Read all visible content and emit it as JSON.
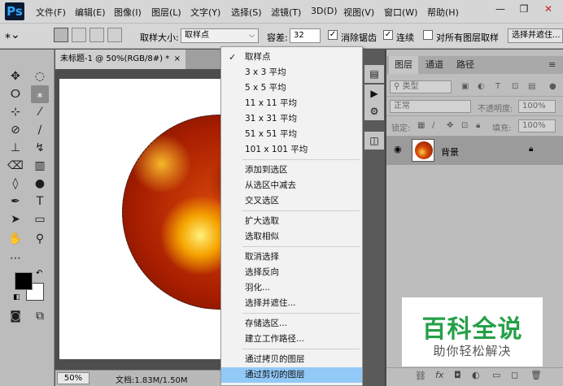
{
  "app": {
    "logo": "Ps"
  },
  "menubar": {
    "items": [
      "文件(F)",
      "编辑(E)",
      "图像(I)",
      "图层(L)",
      "文字(Y)",
      "选择(S)",
      "滤镜(T)",
      "3D(D)",
      "视图(V)",
      "窗口(W)",
      "帮助(H)"
    ]
  },
  "window_controls": {
    "minimize": "—",
    "restore": "❐",
    "close": "✕"
  },
  "options_bar": {
    "sample_size_label": "取样大小:",
    "sample_size_value": "取样点",
    "tolerance_label": "容差:",
    "tolerance_value": "32",
    "antialias_label": "消除锯齿",
    "contiguous_label": "连续",
    "all_layers_label": "对所有图层取样",
    "select_mask_label": "选择并遮住..."
  },
  "document": {
    "tab_title": "未标题-1 @ 50%(RGB/8#) *",
    "tab_close": "×",
    "zoom": "50%",
    "doc_info": "文档:1.83M/1.50M"
  },
  "context_menu": {
    "items": [
      {
        "label": "取样点",
        "checked": true,
        "group": 0
      },
      {
        "label": "3 x 3 平均",
        "group": 0
      },
      {
        "label": "5 x 5 平均",
        "group": 0
      },
      {
        "label": "11 x 11 平均",
        "group": 0
      },
      {
        "label": "31 x 31 平均",
        "group": 0
      },
      {
        "label": "51 x 51 平均",
        "group": 0
      },
      {
        "label": "101 x 101 平均",
        "group": 0
      },
      {
        "label": "添加到选区",
        "group": 1
      },
      {
        "label": "从选区中减去",
        "group": 1
      },
      {
        "label": "交叉选区",
        "group": 1
      },
      {
        "label": "扩大选取",
        "group": 2
      },
      {
        "label": "选取相似",
        "group": 2
      },
      {
        "label": "取消选择",
        "group": 3
      },
      {
        "label": "选择反向",
        "group": 3
      },
      {
        "label": "羽化...",
        "group": 3
      },
      {
        "label": "选择并遮住...",
        "group": 3
      },
      {
        "label": "存储选区...",
        "group": 4
      },
      {
        "label": "建立工作路径...",
        "group": 4
      },
      {
        "label": "通过拷贝的图层",
        "group": 5
      },
      {
        "label": "通过剪切的图层",
        "group": 5,
        "highlighted": true
      }
    ]
  },
  "layers_panel": {
    "tabs": [
      "图层",
      "通道",
      "路径"
    ],
    "kind_filter": "类型",
    "blend_mode": "正常",
    "opacity_label": "不透明度:",
    "opacity_value": "100%",
    "lock_label": "锁定:",
    "fill_label": "填充:",
    "fill_value": "100%",
    "layer_name": "背景"
  },
  "watermark": {
    "title": "百科全说",
    "subtitle": "助你轻松解决"
  },
  "colors": {
    "highlight": "#91c9f7",
    "watermark_green": "#25a048"
  }
}
